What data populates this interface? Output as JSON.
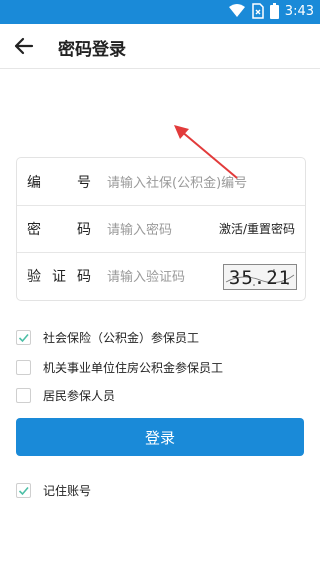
{
  "status_bar": {
    "time": "3:43"
  },
  "appbar": {
    "title": "密码登录"
  },
  "form": {
    "account": {
      "label": [
        "编",
        "号"
      ],
      "placeholder": "请输入社保(公积金)编号"
    },
    "password": {
      "label": [
        "密",
        "码"
      ],
      "placeholder": "请输入密码",
      "action": "激活/重置密码"
    },
    "captcha": {
      "label": [
        "验",
        "证",
        "码"
      ],
      "placeholder": "请输入验证码",
      "image_text": "35.21"
    }
  },
  "user_types": [
    {
      "label": "社会保险（公积金）参保员工",
      "checked": true
    },
    {
      "label": "机关事业单位住房公积金参保员工",
      "checked": false
    },
    {
      "label": "居民参保人员",
      "checked": false
    }
  ],
  "login_button": "登录",
  "remember": {
    "label": "记住账号",
    "checked": true
  },
  "colors": {
    "primary": "#1a8ad8",
    "check": "#4cbfa6",
    "arrow": "#e23b3b"
  }
}
